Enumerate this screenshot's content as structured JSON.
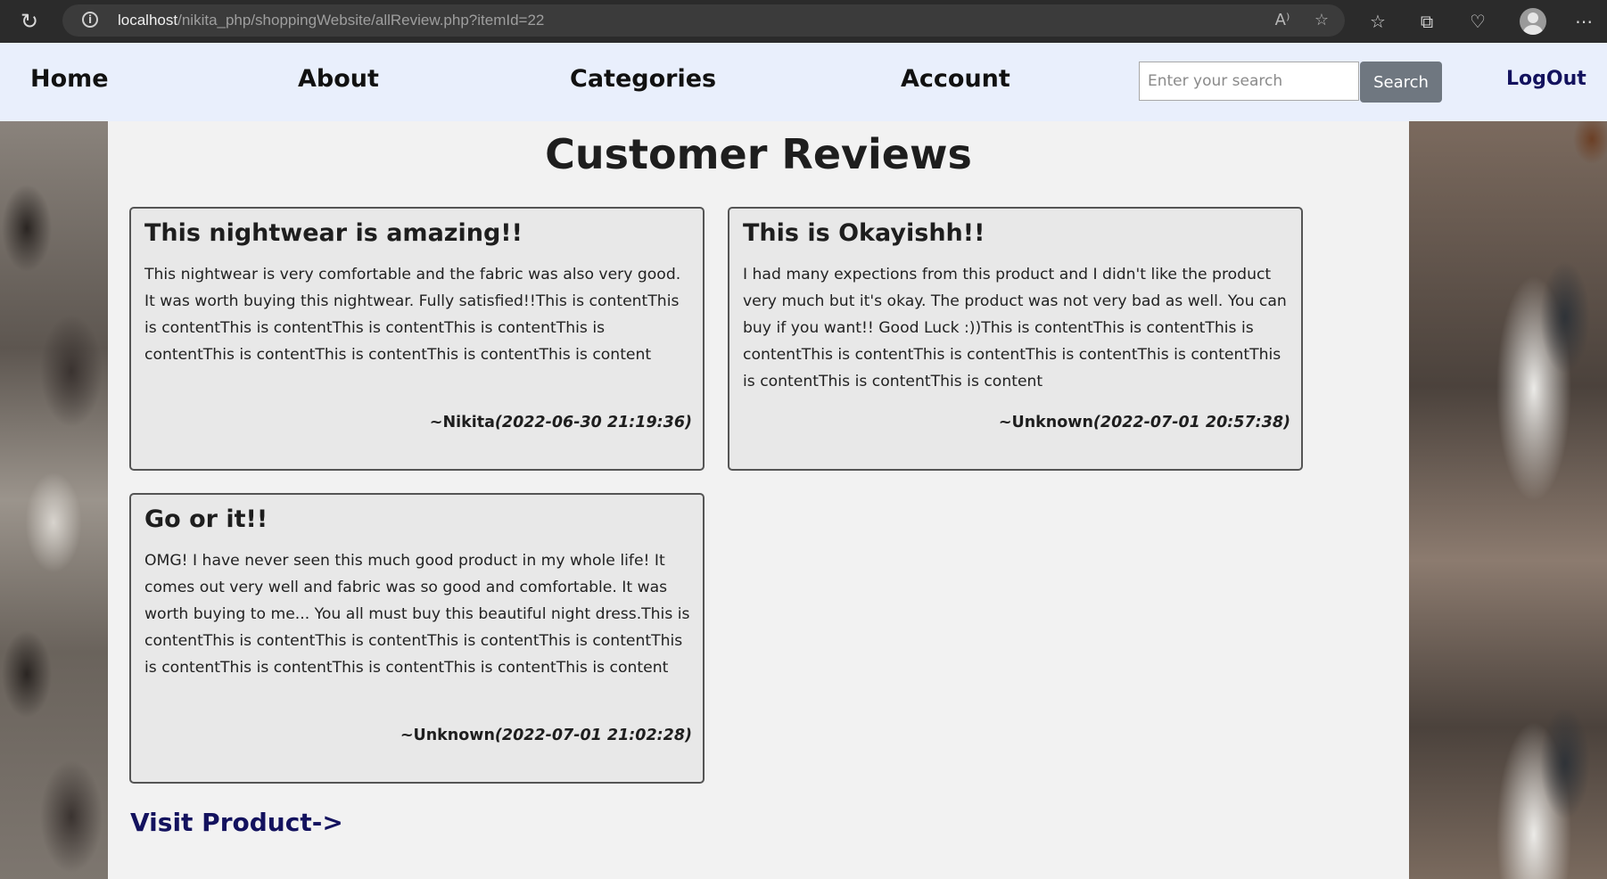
{
  "browser": {
    "url_host": "localhost",
    "url_path": "/nikita_php/shoppingWebsite/allReview.php?itemId=22"
  },
  "nav": {
    "home": "Home",
    "about": "About",
    "categories": "Categories",
    "account": "Account",
    "search_placeholder": "Enter your search",
    "search_button": "Search",
    "logout": "LogOut"
  },
  "page": {
    "title": "Customer Reviews",
    "visit_link": "Visit Product->"
  },
  "reviews": [
    {
      "title": "This nightwear is amazing!!",
      "body": "This nightwear is very comfortable and the fabric was also very good. It was worth buying this nightwear. Fully satisfied!!This is contentThis is contentThis is contentThis is contentThis is contentThis is contentThis is contentThis is contentThis is contentThis is content",
      "author": "~Nikita",
      "date": "(2022-06-30 21:19:36)"
    },
    {
      "title": "This is Okayishh!!",
      "body": "I had many expections from this product and I didn't like the product very much but it's okay. The product was not very bad as well. You can buy if you want!! Good Luck :))This is contentThis is contentThis is contentThis is contentThis is contentThis is contentThis is contentThis is contentThis is contentThis is content",
      "author": "~Unknown",
      "date": "(2022-07-01 20:57:38)"
    },
    {
      "title": "Go or it!!",
      "body": "OMG! I have never seen this much good product in my whole life! It comes out very well and fabric was so good and comfortable. It was worth buying to me... You all must buy this beautiful night dress.This is contentThis is contentThis is contentThis is contentThis is contentThis is contentThis is contentThis is contentThis is contentThis is content",
      "author": "~Unknown",
      "date": "(2022-07-01 21:02:28)"
    }
  ]
}
